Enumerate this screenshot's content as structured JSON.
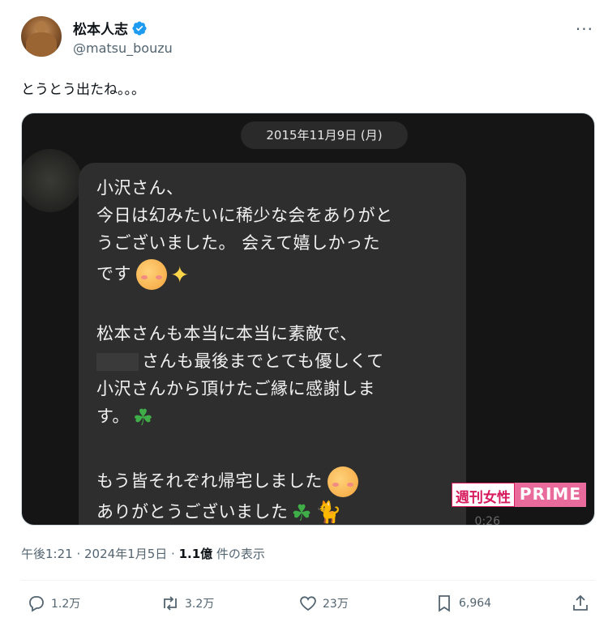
{
  "author": {
    "display_name": "松本人志",
    "handle": "@matsu_bouzu"
  },
  "tweet": {
    "text": "とうとう出たね。。。"
  },
  "media": {
    "date_pill": "2015年11月9日 (月)",
    "message_lines": [
      "小沢さん、",
      "今日は幻みたいに稀少な会をありがと",
      "うございました。 会えて嬉しかった",
      "です",
      "松本さんも本当に本当に素敵で、",
      "さんも最後までとても優しくて",
      "小沢さんから頂けたご縁に感謝しま",
      "す。",
      "もう皆それぞれ帰宅しました",
      "ありがとうございました"
    ],
    "watermark_left": "週刊女性",
    "watermark_right": "PRIME",
    "timestamp": "0:26"
  },
  "meta": {
    "time": "午後1:21 · 2024年1月5日 · ",
    "views_count": "1.1億",
    "views_label": " 件の表示"
  },
  "actions": {
    "replies": "1.2万",
    "retweets": "3.2万",
    "likes": "23万",
    "bookmarks": "6,964"
  },
  "colors": {
    "verified": "#1d9bf0",
    "text_secondary": "#536471",
    "media_bg": "#151515"
  }
}
